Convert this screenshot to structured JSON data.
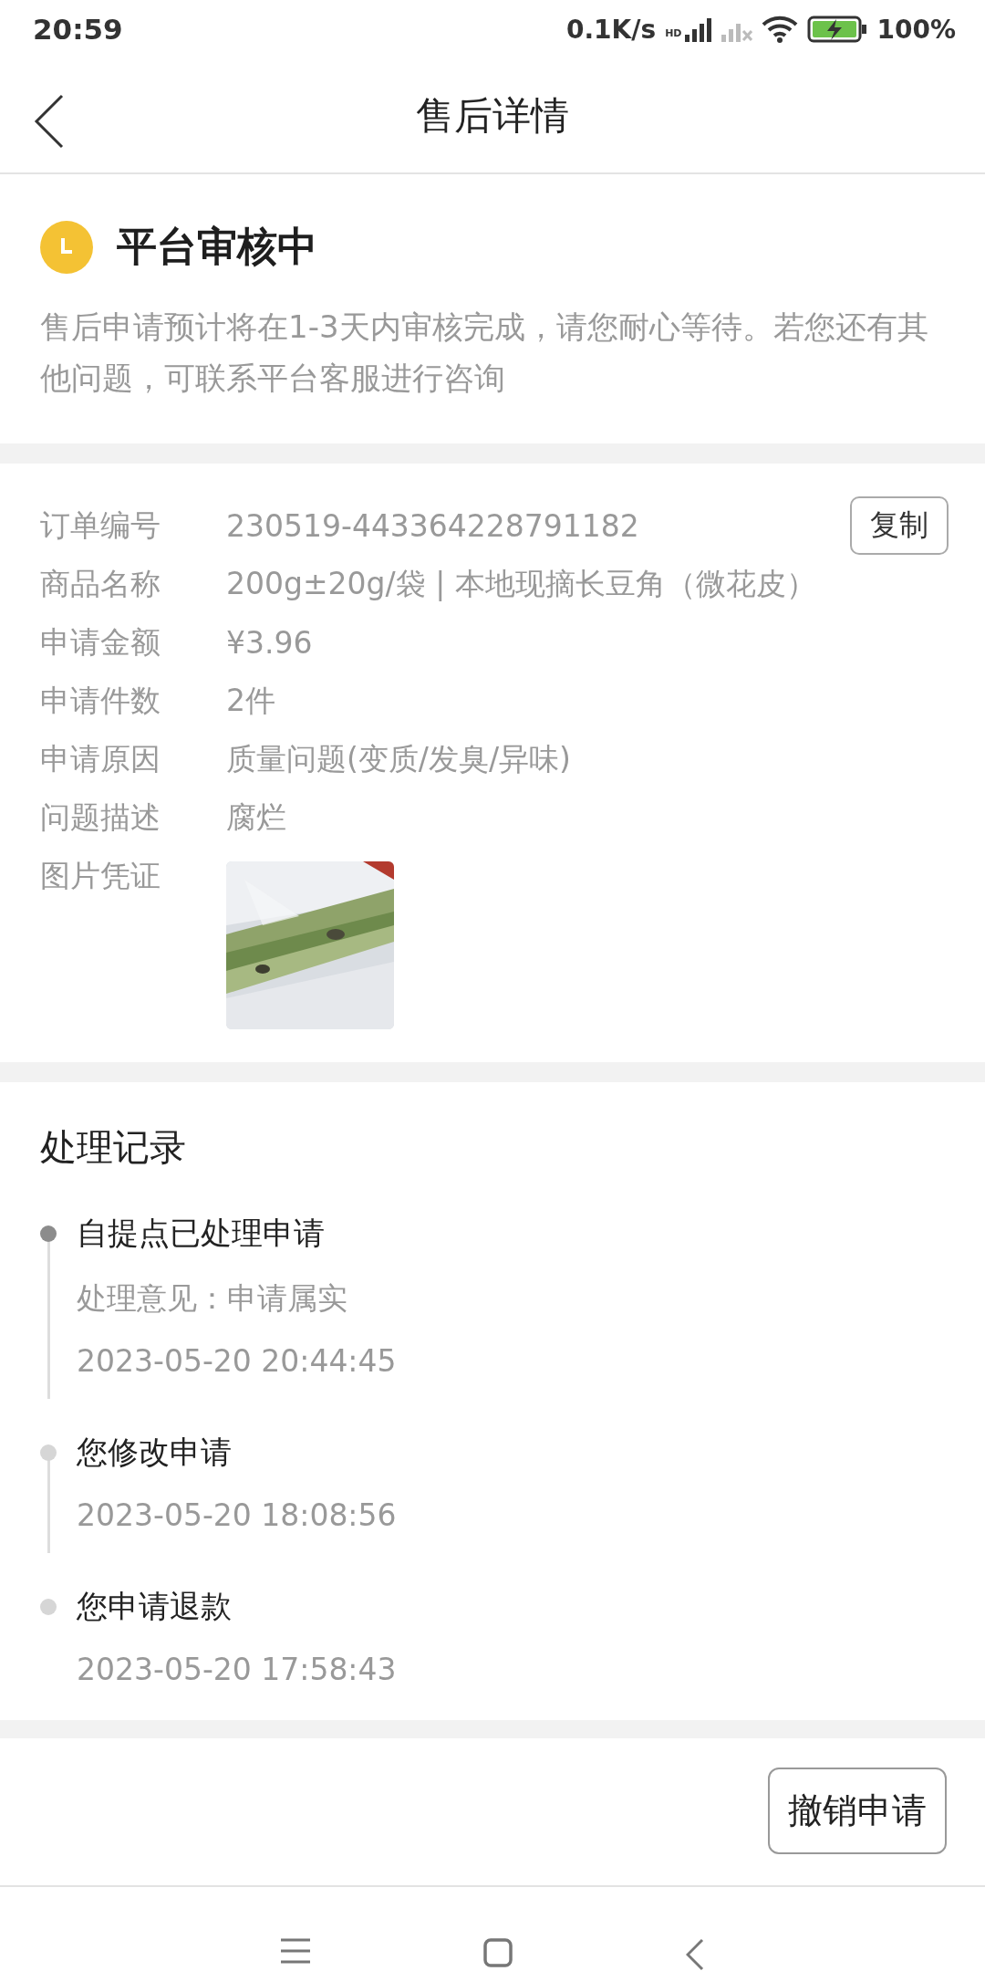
{
  "status_bar": {
    "time": "20:59",
    "speed": "0.1K/s",
    "network_badge": "HD",
    "battery": "100%"
  },
  "header": {
    "title": "售后详情"
  },
  "review": {
    "title": "平台审核中",
    "description": "售后申请预计将在1-3天内审核完成，请您耐心等待。若您还有其他问题，可联系平台客服进行咨询"
  },
  "details": {
    "copy_button": "复制",
    "rows": [
      {
        "label": "订单编号",
        "value": "230519-443364228791182"
      },
      {
        "label": "商品名称",
        "value": "200g±20g/袋 | 本地现摘长豆角（微花皮）"
      },
      {
        "label": "申请金额",
        "value": "¥3.96"
      },
      {
        "label": "申请件数",
        "value": "2件"
      },
      {
        "label": "申请原因",
        "value": "质量问题(变质/发臭/异味)"
      },
      {
        "label": "问题描述",
        "value": "腐烂"
      }
    ],
    "evidence": {
      "label": "图片凭证",
      "kind": "picture"
    }
  },
  "records": {
    "title": "处理记录",
    "items": [
      {
        "title": "自提点已处理申请",
        "note": "处理意见：申请属实",
        "time": "2023-05-20 20:44:45",
        "latest": true
      },
      {
        "title": "您修改申请",
        "time": "2023-05-20 18:08:56",
        "latest": false
      },
      {
        "title": "您申请退款",
        "time": "2023-05-20 17:58:43",
        "latest": false
      }
    ]
  },
  "actions": {
    "cancel_button": "撤销申请"
  }
}
